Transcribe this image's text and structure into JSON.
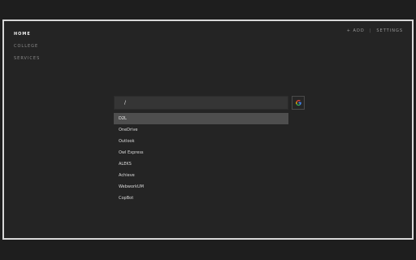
{
  "nav": {
    "items": [
      {
        "label": "HOME",
        "active": true
      },
      {
        "label": "COLLEGE",
        "active": false
      },
      {
        "label": "SERVICES",
        "active": false
      }
    ]
  },
  "topbar": {
    "add_label": "+ ADD",
    "separator": "|",
    "settings_label": "SETTINGS"
  },
  "search": {
    "value": "/",
    "engine_icon": "google-icon"
  },
  "results": [
    "D2L",
    "OneDrive",
    "Outlook",
    "Owl Express",
    "ALEKS",
    "Achieve",
    "WebworkUM",
    "CopBot"
  ],
  "colors": {
    "background": "#242424",
    "border": "#d8d8d8",
    "selected_row": "#4e4e4e",
    "search_box": "#353535"
  }
}
